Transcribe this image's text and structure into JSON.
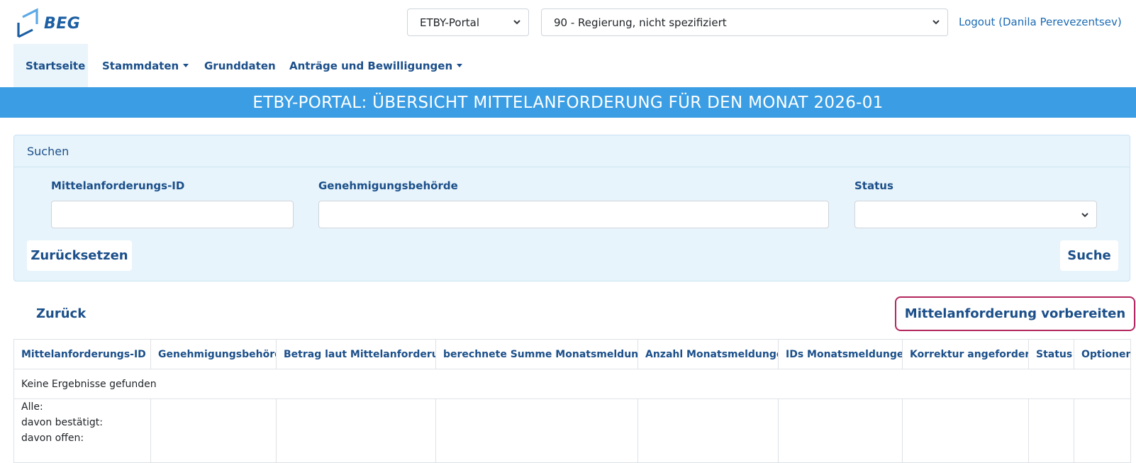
{
  "header": {
    "logo_text": "BEG",
    "portal_select": "ETBY-Portal",
    "org_select": "90 - Regierung, nicht spezifiziert",
    "logout": "Logout (Danila Perevezentsev)"
  },
  "nav": {
    "items": [
      {
        "label": "Startseite",
        "dropdown": false
      },
      {
        "label": "Stammdaten",
        "dropdown": true
      },
      {
        "label": "Grunddaten",
        "dropdown": false
      },
      {
        "label": "Anträge und Bewilligungen",
        "dropdown": true
      }
    ]
  },
  "banner": {
    "title": "ETBY-PORTAL: ÜBERSICHT MITTELANFORDERUNG FÜR DEN MONAT 2026-01"
  },
  "search": {
    "heading": "Suchen",
    "id_label": "Mittelanforderungs-ID",
    "id_value": "",
    "authority_label": "Genehmigungsbehörde",
    "authority_value": "",
    "status_label": "Status",
    "status_value": "",
    "reset": "Zurücksetzen",
    "submit": "Suche"
  },
  "actions": {
    "back": "Zurück",
    "prepare": "Mittelanforderung vorbereiten"
  },
  "table": {
    "columns": [
      "Mittelanforderungs-ID",
      "Genehmigungsbehörde",
      "Betrag laut Mittelanforderung",
      "berechnete Summe Monatsmeldungen",
      "Anzahl Monatsmeldungen",
      "IDs Monatsmeldungen",
      "Korrektur angefordert?",
      "Status",
      "Optionen"
    ],
    "sorted_column": 0,
    "sort_direction": "asc",
    "empty_message": "Keine Ergebnisse gefunden",
    "summary": {
      "all": "Alle:",
      "confirmed": "davon bestätigt:",
      "open": "davon offen:"
    }
  },
  "colors": {
    "banner": "#3b9ee4",
    "link": "#1b4f8a",
    "panel": "#e8f4fb",
    "accent_border": "#b3265e"
  }
}
